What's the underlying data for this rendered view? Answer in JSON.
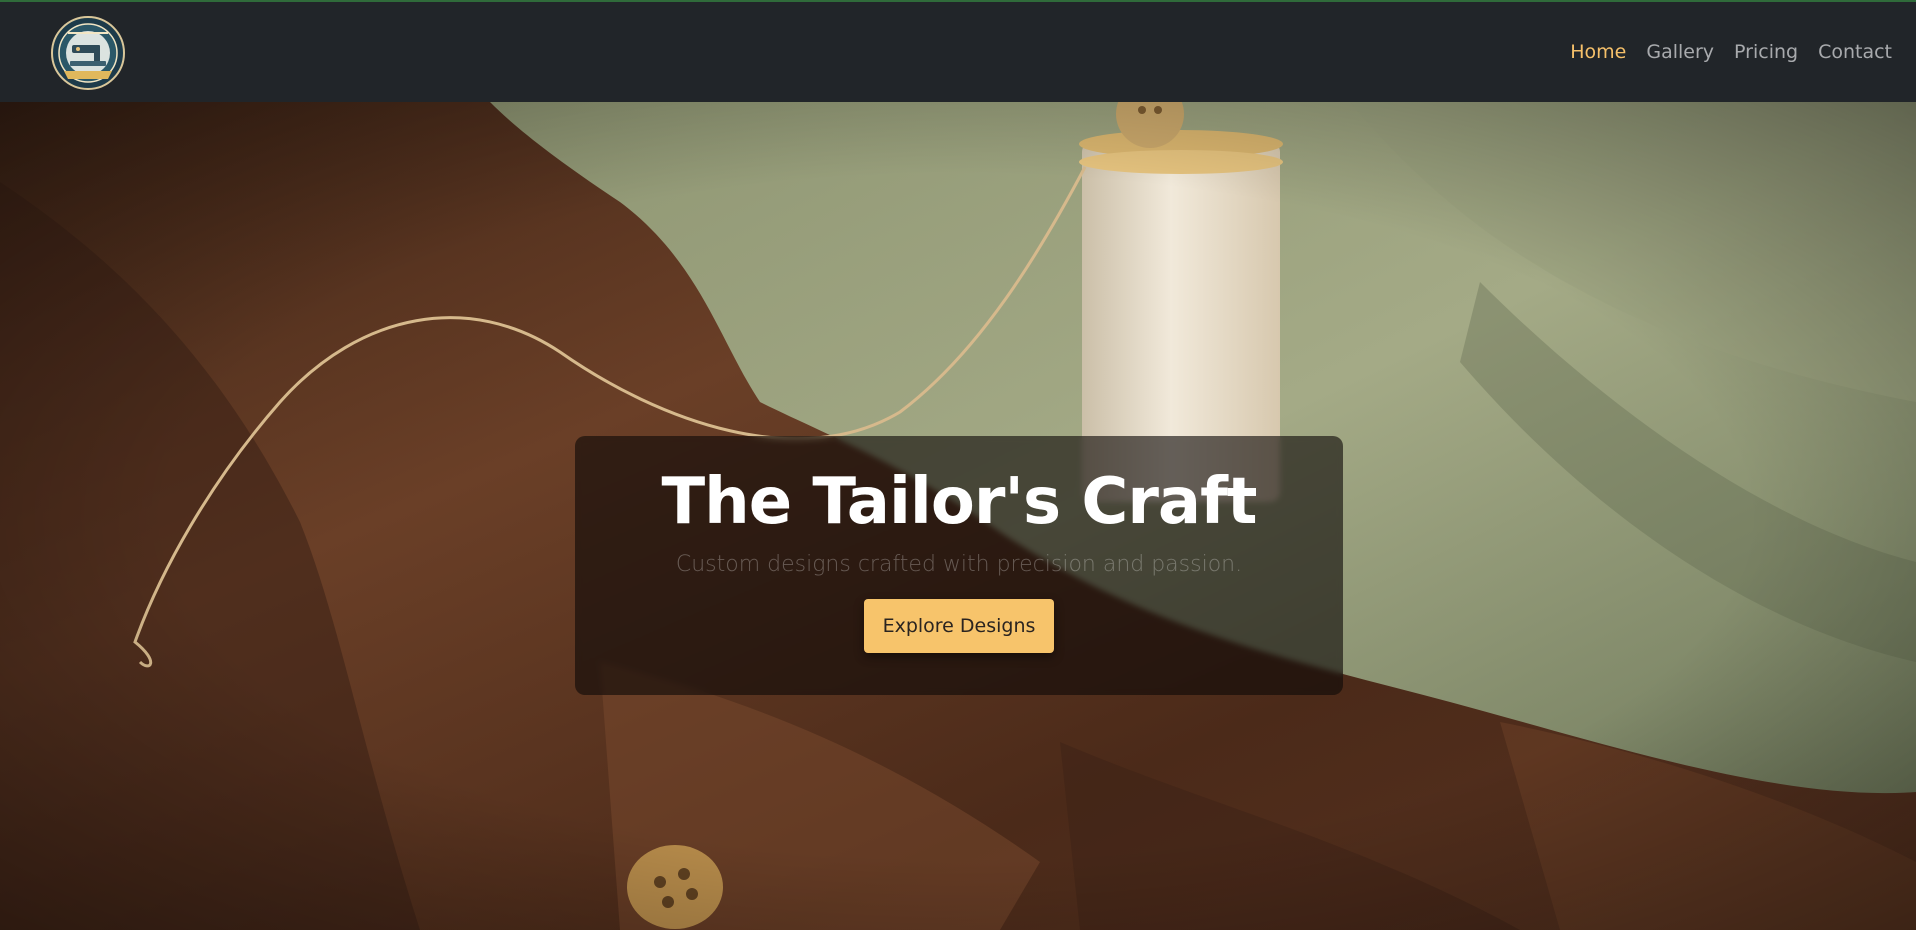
{
  "nav": {
    "logo_icon": "tailoring-logo-icon",
    "links": [
      {
        "label": "Home",
        "active": true
      },
      {
        "label": "Gallery",
        "active": false
      },
      {
        "label": "Pricing",
        "active": false
      },
      {
        "label": "Contact",
        "active": false
      }
    ]
  },
  "hero": {
    "background_icon": "fabric-thread-spool-photo",
    "title": "The Tailor's Craft",
    "subtitle": "Custom designs crafted with precision and passion.",
    "cta_label": "Explore Designs"
  },
  "colors": {
    "navbar_bg": "#212529",
    "accent": "#f7c46b",
    "active_link": "#f5c06a",
    "link": "#a8aaad"
  }
}
